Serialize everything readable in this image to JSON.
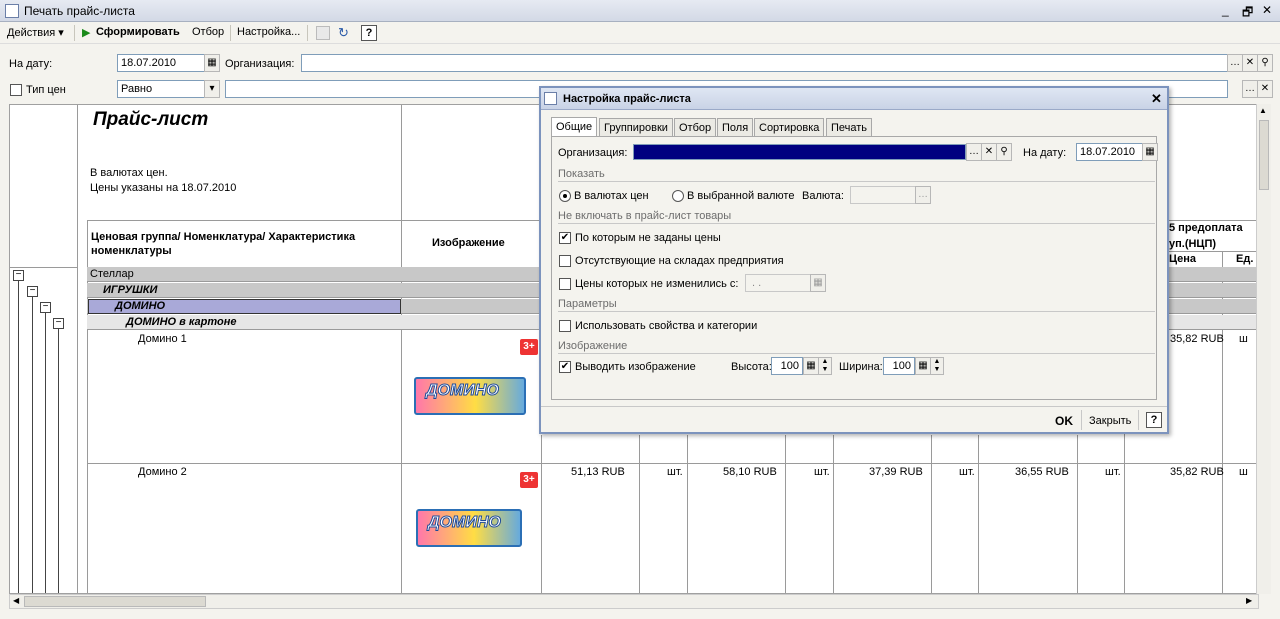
{
  "window": {
    "title": "Печать прайс-листа",
    "controls": [
      "_",
      "🗗",
      "✕"
    ]
  },
  "toolbar": {
    "actions": "Действия",
    "generate": "Сформировать",
    "filter": "Отбор",
    "settings": "Настройка...",
    "help": "?"
  },
  "form": {
    "date_label": "На дату:",
    "date_value": "18.07.2010",
    "org_label": "Организация:",
    "org_value": "",
    "price_type_label": "Тип цен",
    "price_type_checked": false,
    "condition_value": "Равно",
    "condition_field": ""
  },
  "report": {
    "title": "Прайс-лист",
    "currency_note": "В валютах цен.",
    "price_date_note": "Цены указаны на 18.07.2010",
    "header_col1": "Ценовая группа/ Номенклатура/ Характеристика номенклатуры",
    "header_col2": "Изображение",
    "header_right_top": "5 предоплата",
    "header_right_mid": "уп.(НЦП)",
    "header_right_price": "Цена",
    "header_right_unit": "Ед.",
    "groups": [
      {
        "label": "Стеллар",
        "level": 0
      },
      {
        "label": "ИГРУШКИ",
        "level": 1
      },
      {
        "label": "ДОМИНО",
        "level": 2
      },
      {
        "label": "ДОМИНО в картоне",
        "level": 3
      }
    ],
    "items": [
      {
        "name": "Домино 1",
        "age": "3+",
        "box_word": "ДОМИНО",
        "prices": [
          "",
          "",
          "",
          "",
          "35,82 RUB"
        ],
        "units": [
          "",
          "",
          "",
          "",
          "ш"
        ]
      },
      {
        "name": "Домино 2",
        "age": "3+",
        "box_word": "ДОМИНО",
        "prices": [
          "51,13 RUB",
          "58,10 RUB",
          "37,39 RUB",
          "36,55 RUB",
          "35,82 RUB"
        ],
        "units": [
          "шт.",
          "шт.",
          "шт.",
          "шт.",
          "ш"
        ]
      }
    ]
  },
  "dialog": {
    "title": "Настройка прайс-листа",
    "tabs": [
      "Общие",
      "Группировки",
      "Отбор",
      "Поля",
      "Сортировка",
      "Печать"
    ],
    "org_label": "Организация:",
    "date_label": "На дату:",
    "date_value": "18.07.2010",
    "show_section": "Показать",
    "radio_price_currency": "В валютах цен",
    "radio_selected_currency": "В выбранной валюте",
    "currency_label": "Валюта:",
    "exclude_section": "Не включать в прайс-лист товары",
    "cb_no_prices": "По которым не заданы цены",
    "cb_missing": "Отсутствующие на складах предприятия",
    "cb_unchanged": "Цены которых не изменились с:",
    "unchanged_date": ". .",
    "params_section": "Параметры",
    "cb_props": "Использовать свойства и категории",
    "image_section": "Изображение",
    "cb_show_image": "Выводить изображение",
    "height_label": "Высота:",
    "height_value": "100",
    "width_label": "Ширина:",
    "width_value": "100",
    "ok": "OK",
    "close": "Закрыть",
    "help": "?"
  }
}
